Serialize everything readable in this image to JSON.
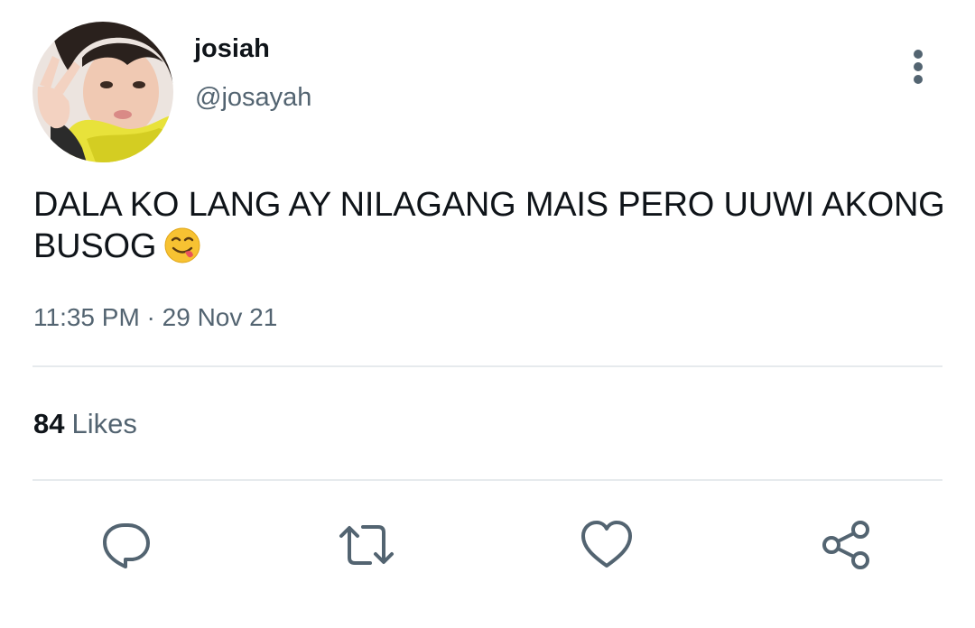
{
  "user": {
    "display_name": "josiah",
    "handle": "@josayah"
  },
  "tweet": {
    "text": "DALA KO LANG AY NILAGANG MAIS PERO UUWI AKONG BUSOG",
    "emoji_icon": "face-savoring-food-emoji",
    "timestamp": "11:35 PM · 29 Nov 21"
  },
  "stats": {
    "likes_count": "84",
    "likes_label": "Likes"
  },
  "actions": {
    "reply_icon": "reply-icon",
    "retweet_icon": "retweet-icon",
    "like_icon": "heart-icon",
    "share_icon": "share-icon"
  },
  "colors": {
    "text_primary": "#0f1419",
    "text_secondary": "#536471",
    "divider": "#e6eaed",
    "icon": "#536471"
  }
}
